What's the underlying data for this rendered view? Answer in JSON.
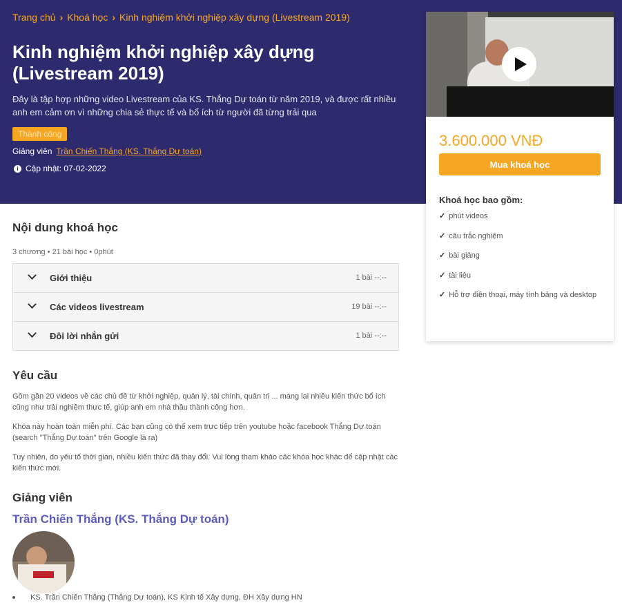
{
  "breadcrumb": {
    "items": [
      "Trang chủ",
      "Khoá học",
      "Kinh nghiệm khởi nghiệp xây dựng (Livestream 2019)"
    ]
  },
  "course": {
    "title": "Kinh nghiệm khởi nghiệp xây dựng (Livestream 2019)",
    "description": "Đây là tập hợp những video Livestream của KS. Thắng Dự toán từ năm 2019, và được rất nhiều anh em cảm ơn vì những chia sẻ thực tế và bổ ích từ người đã từng trải qua",
    "badge": "Thành công",
    "teacher_label": "Giảng viên",
    "teacher_name": "Trần Chiến Thắng (KS. Thắng Dự toán)",
    "updated": "Cập nhật: 07-02-2022"
  },
  "card": {
    "price": "3.600.000 VNĐ",
    "buy_label": "Mua khoá học",
    "includes_title": "Khoá học bao gồm:",
    "includes": [
      "phút videos",
      "câu trắc nghiệm",
      "bài giảng",
      "tài liệu",
      "Hỗ trợ điện thoại, máy tính bảng và desktop"
    ]
  },
  "content": {
    "title": "Nội dung khoá học",
    "meta": "3 chương • 21 bài học • 0phút",
    "sections": [
      {
        "label": "Giới thiệu",
        "count": "1 bài --:--"
      },
      {
        "label": "Các videos livestream",
        "count": "19 bài --:--"
      },
      {
        "label": "Đôi lời nhắn gửi",
        "count": "1 bài --:--"
      }
    ]
  },
  "requirements": {
    "title": "Yêu cầu",
    "paragraphs": [
      "Gồm gần 20 videos về các chủ đề từ khởi nghiệp, quản lý, tài chính, quản trị ... mang lại nhiều kiến thức bổ ích cũng như trải nghiệm thực tế, giúp anh em nhà thầu thành công hơn.",
      "Khóa này hoàn toàn miễn phí. Các bạn cũng có thể xem trực tiếp trên youtube hoặc facebook Thắng Dự toán (search \"Thắng Dự toán\" trên Google là ra)",
      "Tuy nhiên, do yếu tố thời gian, nhiều kiến thức đã thay đổi. Vui lòng tham khảo các khóa học khác để cập nhật các kiến thức mới."
    ]
  },
  "instructor": {
    "title": "Giảng viên",
    "name": "Trần Chiến Thắng (KS. Thắng Dự toán)",
    "bio": "KS. Trần Chiến Thắng (Thắng Dự toán), KS Kinh tế Xây dựng, ĐH Xây dựng HN"
  },
  "colors": {
    "hero_bg": "#2e2a6e",
    "accent": "#f5a623",
    "instructor_link": "#5b5bbf"
  },
  "icons": [
    "chevron-right-icon",
    "info-icon",
    "play-icon",
    "check-icon",
    "chevron-down-icon"
  ]
}
